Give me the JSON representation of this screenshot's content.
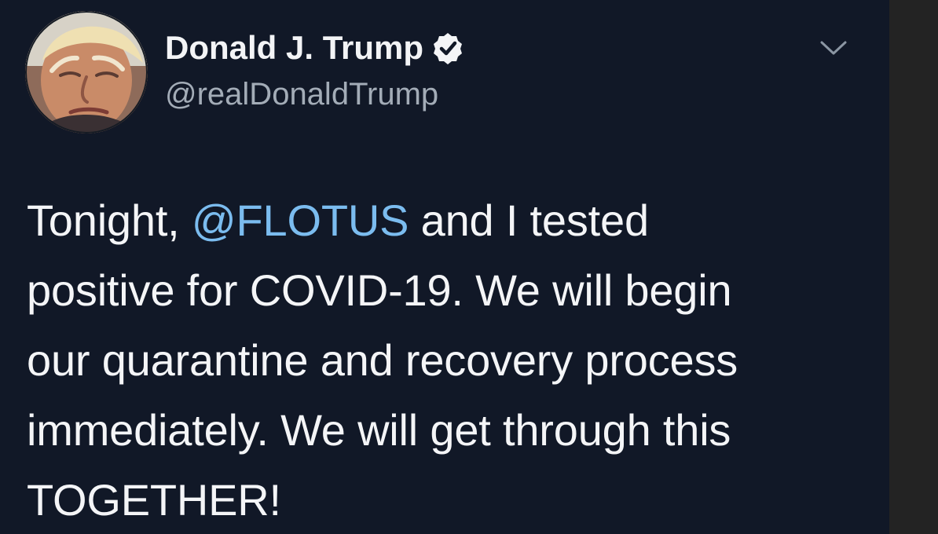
{
  "tweet": {
    "author": {
      "display_name": "Donald J. Trump",
      "handle": "@realDonaldTrump",
      "verified_icon": "verified-badge-icon",
      "avatar_icon": "profile-avatar"
    },
    "menu_icon": "chevron-down-icon",
    "text": {
      "line1_prefix": "Tonight, ",
      "line1_mention": "@FLOTUS",
      "line1_suffix": " and I tested",
      "line2": "positive for COVID-19. We will begin",
      "line3": "our quarantine and recovery process",
      "line4": "immediately. We will get through this",
      "line5": "TOGETHER!"
    }
  }
}
